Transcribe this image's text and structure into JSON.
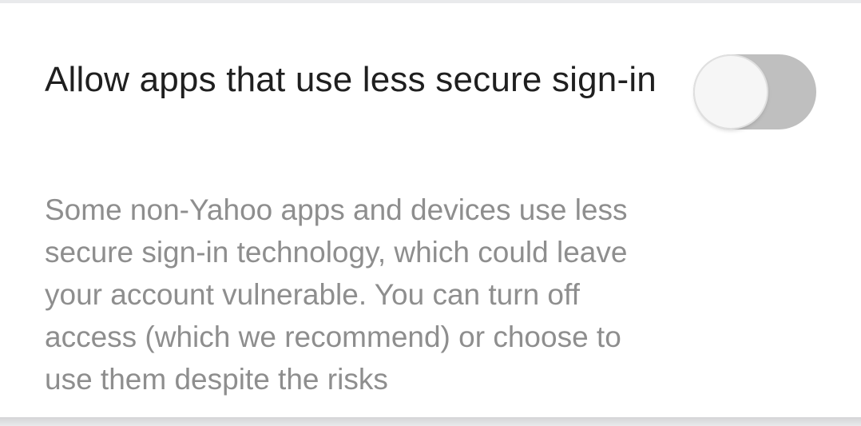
{
  "setting": {
    "title": "Allow apps that use less secure sign-in",
    "description": "Some non-Yahoo apps and devices use less secure sign-in technology, which could leave your account vulnerable. You can turn off access (which we recommend) or choose to use them despite the risks",
    "toggle_state": "off"
  },
  "colors": {
    "toggle_track_off": "#bfbfbf",
    "toggle_knob": "#f6f6f6",
    "title_text": "#1f1f1f",
    "description_text": "#8e8e8e"
  }
}
